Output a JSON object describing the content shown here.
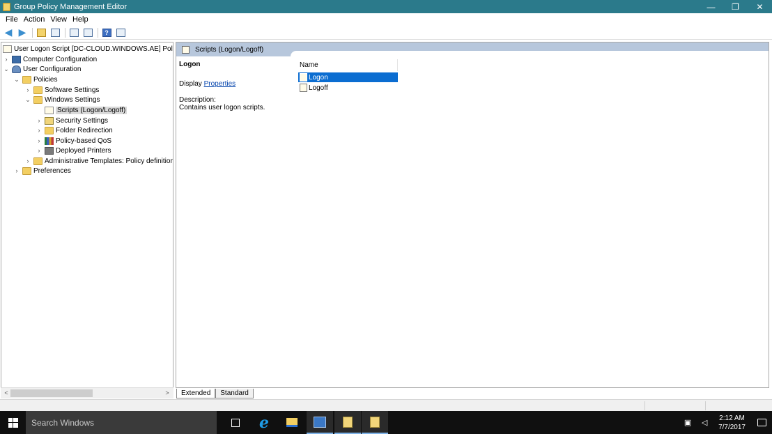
{
  "window": {
    "title": "Group Policy Management Editor",
    "controls": {
      "minimize": "—",
      "restore": "❐",
      "close": "✕"
    }
  },
  "menu": [
    "File",
    "Action",
    "View",
    "Help"
  ],
  "tree": {
    "items": [
      {
        "label": "User Logon Script [DC-CLOUD.WINDOWS.AE] Policy",
        "icon": "script-icon",
        "expander": ""
      },
      {
        "label": "Computer Configuration",
        "icon": "computer-icon",
        "expander": "›"
      },
      {
        "label": "User Configuration",
        "icon": "user-icon",
        "expander": "⌄"
      },
      {
        "label": "Policies",
        "icon": "folder-icon",
        "expander": "⌄"
      },
      {
        "label": "Software Settings",
        "icon": "folder-icon",
        "expander": "›"
      },
      {
        "label": "Windows Settings",
        "icon": "folder-icon",
        "expander": "⌄"
      },
      {
        "label": "Scripts (Logon/Logoff)",
        "icon": "script-icon",
        "expander": ""
      },
      {
        "label": "Security Settings",
        "icon": "security-icon",
        "expander": "›"
      },
      {
        "label": "Folder Redirection",
        "icon": "folder-icon",
        "expander": "›"
      },
      {
        "label": "Policy-based QoS",
        "icon": "qos-icon",
        "expander": "›"
      },
      {
        "label": "Deployed Printers",
        "icon": "printer-icon",
        "expander": "›"
      },
      {
        "label": "Administrative Templates: Policy definition",
        "icon": "folder-icon",
        "expander": "›"
      },
      {
        "label": "Preferences",
        "icon": "folder-icon",
        "expander": "›"
      }
    ],
    "selected": "Scripts (Logon/Logoff)"
  },
  "right_pane": {
    "header": "Scripts (Logon/Logoff)",
    "detail": {
      "title": "Logon",
      "display_prefix": "Display ",
      "properties_link": "Properties",
      "description_label": "Description:",
      "description_text": "Contains user logon scripts."
    },
    "list": {
      "column": "Name",
      "items": [
        "Logon",
        "Logoff"
      ],
      "selected": "Logon"
    }
  },
  "tabs": [
    "Extended",
    "Standard"
  ],
  "taskbar": {
    "search_placeholder": "Search Windows",
    "clock_time": "2:12 AM",
    "clock_date": "7/7/2017"
  },
  "scroll": {
    "left": "<",
    "right": ">"
  }
}
